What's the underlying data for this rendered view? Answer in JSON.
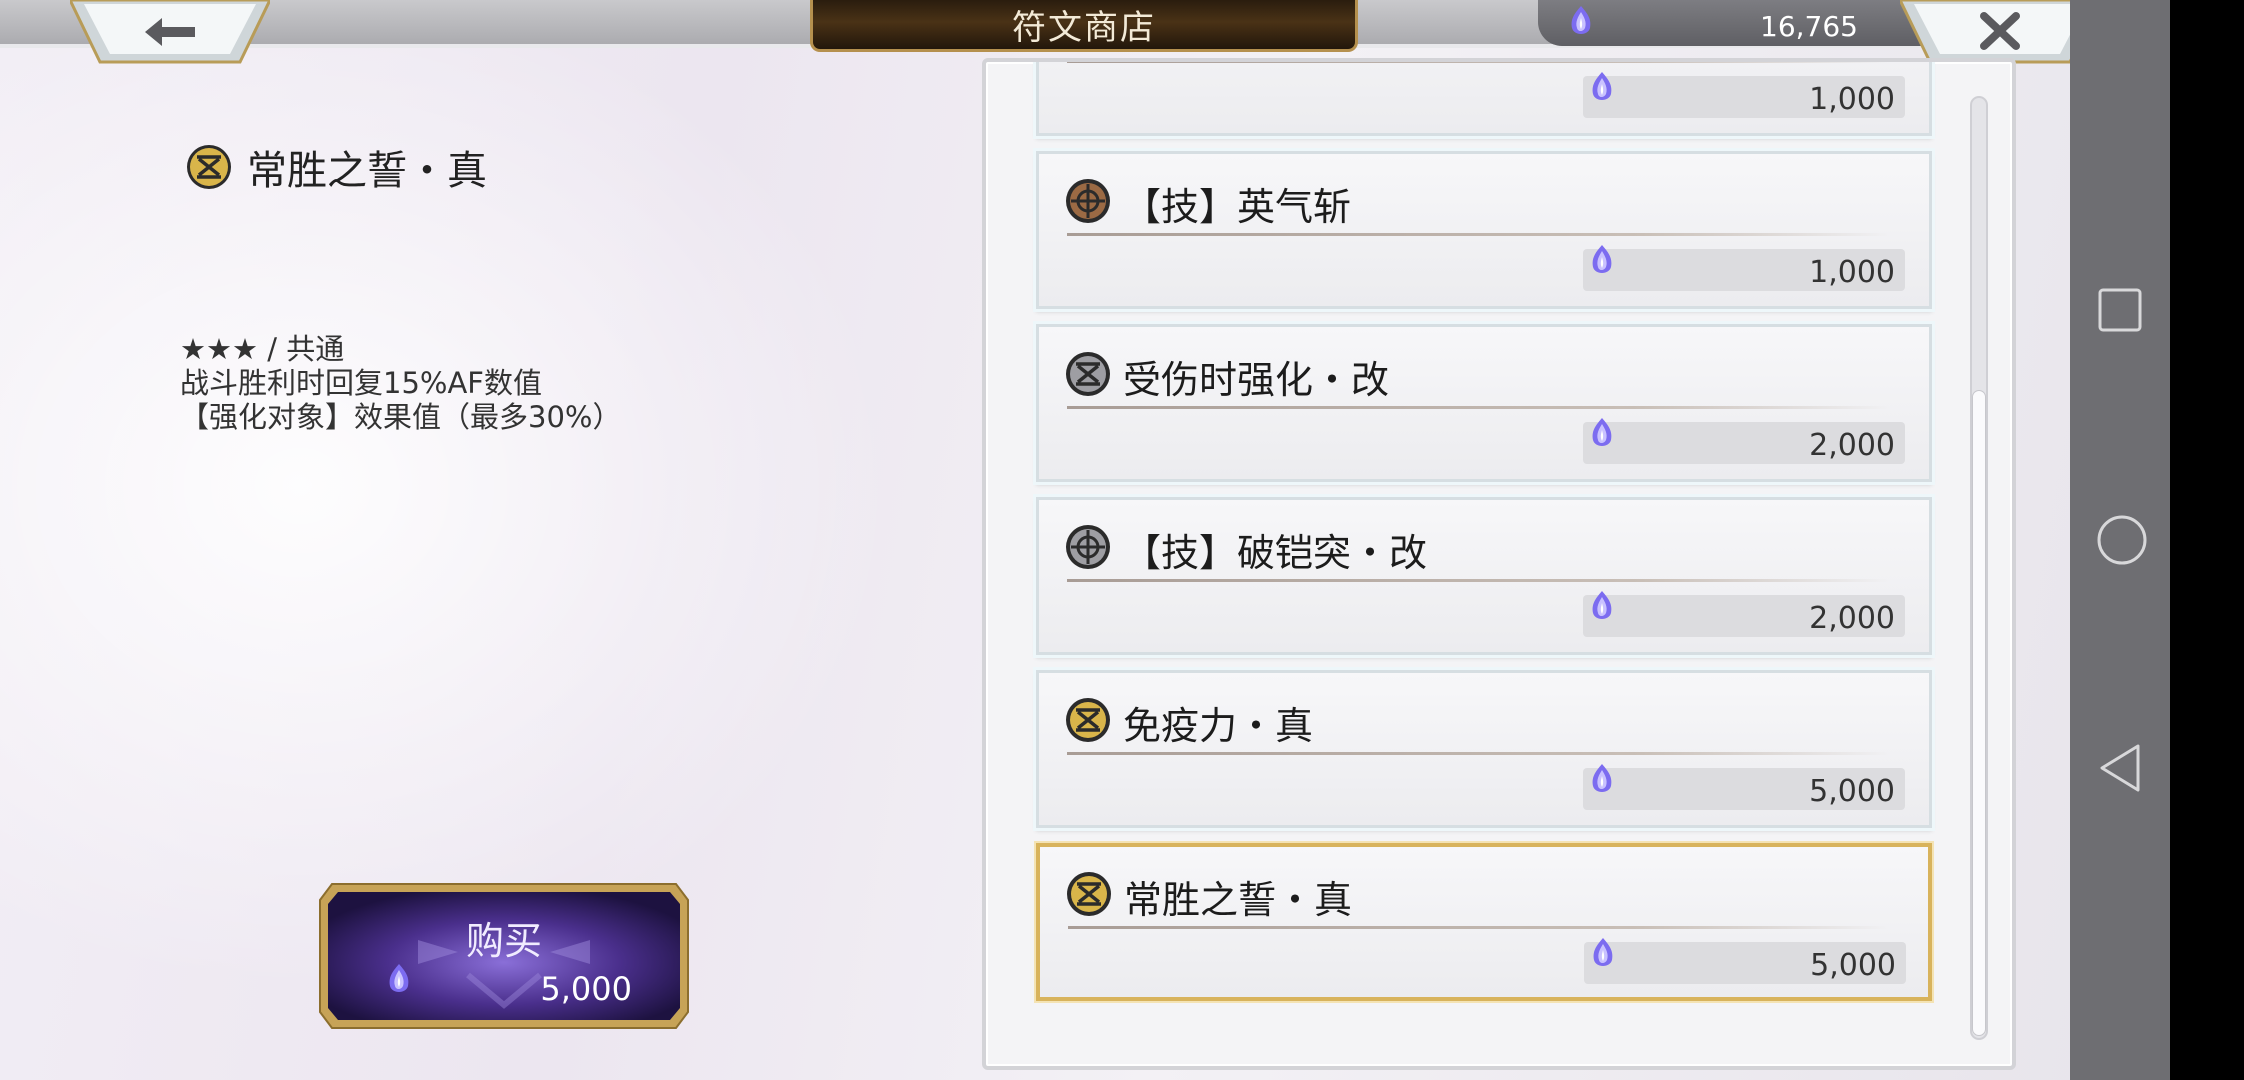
{
  "header": {
    "title": "符文商店",
    "currency_amount": "16,765"
  },
  "detail": {
    "title": "常胜之誓・真",
    "rarity_line": "★★★ / 共通",
    "desc_line1": "战斗胜利时回复15%AF数值",
    "desc_line2": "【强化对象】效果值（最多30%）",
    "buy_label": "购买",
    "buy_price": "5,000"
  },
  "shop": {
    "items": [
      {
        "name": "",
        "price": "1,000",
        "icon": "rune-gold-icon"
      },
      {
        "name": "【技】英气斩",
        "price": "1,000",
        "icon": "rune-bronze-icon"
      },
      {
        "name": "受伤时强化・改",
        "price": "2,000",
        "icon": "rune-silver-icon"
      },
      {
        "name": "【技】破铠突・改",
        "price": "2,000",
        "icon": "rune-silver-icon"
      },
      {
        "name": "免疫力・真",
        "price": "5,000",
        "icon": "rune-gold-icon"
      },
      {
        "name": "常胜之誓・真",
        "price": "5,000",
        "icon": "rune-gold-icon"
      }
    ]
  },
  "icons": {
    "back": "arrow-left-icon",
    "close": "close-icon",
    "currency": "crystal-icon"
  },
  "colors": {
    "title_plate": "#3a2812",
    "title_border": "#b5904e",
    "selected_border": "#d8b35c",
    "buy_button": "#4a2f8c"
  }
}
